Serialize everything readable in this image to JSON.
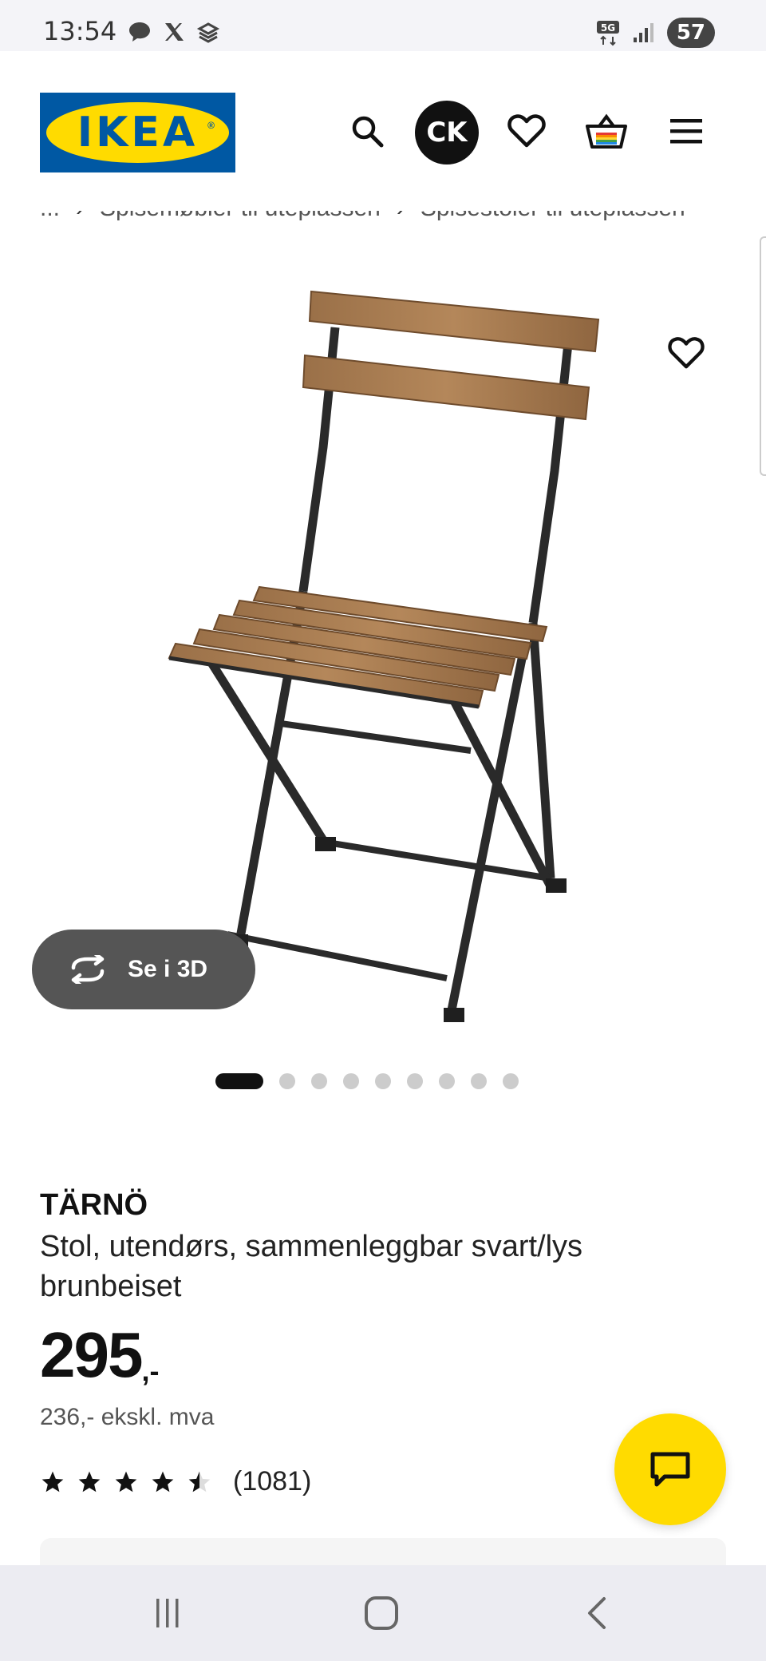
{
  "status_bar": {
    "time": "13:54",
    "battery": "57",
    "network_label": "5G",
    "icons_left": [
      "chat-bubble-icon",
      "x-logo-icon",
      "stack-icon"
    ],
    "icons_right": [
      "5g-icon",
      "signal-icon",
      "battery-icon"
    ]
  },
  "header": {
    "logo_text": "IKEA",
    "logo_reg": "®",
    "avatar_initials": "CK",
    "icons": [
      "search-icon",
      "heart-icon",
      "basket-icon",
      "menu-icon"
    ]
  },
  "breadcrumb": [
    "...",
    "Spisemøbler til uteplassen",
    "Spisestoler til uteplassen"
  ],
  "gallery": {
    "see_3d_label": "Se i 3D",
    "total_images": 9,
    "active_index": 0
  },
  "product": {
    "name": "TÄRNÖ",
    "description": "Stol, utendørs, sammenleggbar svart/lys brunbeiset",
    "price": "295",
    "price_suffix": ",-",
    "price_ex_vat": "236,- ekskl. mva",
    "rating": 4.5,
    "rating_max": 5,
    "review_count": "(1081)"
  },
  "colors": {
    "ikea_blue": "#0058a3",
    "ikea_yellow": "#ffdb00",
    "see3d_bg": "#555555"
  }
}
